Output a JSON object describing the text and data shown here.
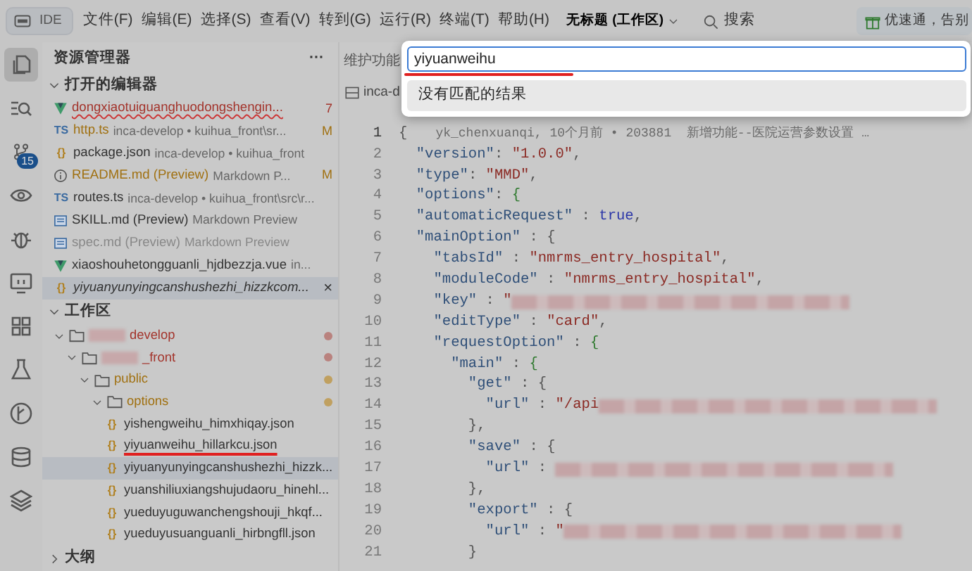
{
  "titlebar": {
    "logo": "IDE",
    "menus": [
      "文件(F)",
      "编辑(E)",
      "选择(S)",
      "查看(V)",
      "转到(G)",
      "运行(R)",
      "终端(T)",
      "帮助(H)"
    ],
    "workspace": "无标题 (工作区)",
    "search": "搜索",
    "promo": "优速通，告别"
  },
  "activity_bar": [
    {
      "kind": "files",
      "selected": true
    },
    {
      "kind": "search",
      "selected": false
    },
    {
      "kind": "source-control",
      "selected": false,
      "badge": "15"
    },
    {
      "kind": "eye",
      "selected": false
    },
    {
      "kind": "debug",
      "selected": false
    },
    {
      "kind": "monitor",
      "selected": false
    },
    {
      "kind": "extensions",
      "selected": false
    },
    {
      "kind": "flask",
      "selected": false
    },
    {
      "kind": "graph",
      "selected": false
    },
    {
      "kind": "database",
      "selected": false
    },
    {
      "kind": "layers",
      "selected": false
    }
  ],
  "sidebar": {
    "title": "资源管理器",
    "more": "···",
    "open_editors": {
      "title": "打开的编辑器",
      "expanded": true,
      "items": [
        {
          "kind": "vue",
          "name": "dongxiaotuiguanghuodongshengin...",
          "badge": "7",
          "error": true,
          "modified": false,
          "dimmed": false,
          "selected": false,
          "preview": false
        },
        {
          "kind": "ts",
          "icon_text": "TS",
          "name": "http.ts",
          "detail": "inca-develop • kuihua_front\\sr...",
          "badge": "M",
          "error": false,
          "modified": true,
          "dimmed": false,
          "selected": false,
          "preview": false
        },
        {
          "kind": "json",
          "icon_text": "{}",
          "name": "package.json",
          "detail": "inca-develop • kuihua_front",
          "error": false,
          "modified": false,
          "dimmed": false,
          "selected": false,
          "preview": false
        },
        {
          "kind": "info",
          "name": "README.md (Preview)",
          "detail": "Markdown P...",
          "badge": "M",
          "error": false,
          "modified": true,
          "dimmed": false,
          "selected": false,
          "preview": false
        },
        {
          "kind": "ts",
          "icon_text": "TS",
          "name": "routes.ts",
          "detail": "inca-develop • kuihua_front\\src\\r...",
          "error": false,
          "modified": false,
          "dimmed": false,
          "selected": false,
          "preview": false
        },
        {
          "kind": "md",
          "name": "SKILL.md (Preview)",
          "detail": "Markdown Preview",
          "error": false,
          "modified": false,
          "dimmed": false,
          "selected": false,
          "preview": false
        },
        {
          "kind": "md",
          "name": "spec.md (Preview)",
          "detail": "Markdown Preview",
          "error": false,
          "modified": false,
          "dimmed": true,
          "selected": false,
          "preview": false
        },
        {
          "kind": "vue",
          "name": "xiaoshouhetongguanli_hjdbezzja.vue",
          "detail": "in...",
          "error": false,
          "modified": false,
          "dimmed": false,
          "selected": false,
          "preview": false
        },
        {
          "kind": "json",
          "icon_text": "{}",
          "name": "yiyuanyunyingcanshushezhi_hizzkcom...",
          "error": false,
          "modified": false,
          "dimmed": false,
          "selected": true,
          "preview": true,
          "close": "×"
        }
      ]
    },
    "workspace": {
      "title": "工作区",
      "expanded": true,
      "tree": [
        {
          "name": "develop",
          "redacted": true,
          "error": true,
          "modified": false,
          "expanded": true,
          "children": [
            {
              "name": "_front",
              "redacted": true,
              "error": true,
              "modified": false,
              "expanded": true,
              "children": [
                {
                  "name": "public",
                  "redacted": false,
                  "error": false,
                  "modified": true,
                  "expanded": true,
                  "children": [
                    {
                      "name": "options",
                      "redacted": false,
                      "error": false,
                      "modified": true,
                      "expanded": true,
                      "children": [
                        {
                          "icon_text": "{}",
                          "name": "yishengweihu_himxhiqay.json",
                          "selected": false,
                          "underlined": false
                        },
                        {
                          "icon_text": "{}",
                          "name": "yiyuanweihu_hillarkcu.json",
                          "selected": false,
                          "underlined": true
                        },
                        {
                          "icon_text": "{}",
                          "name": "yiyuanyunyingcanshushezhi_hizzk...",
                          "selected": true,
                          "underlined": false
                        },
                        {
                          "icon_text": "{}",
                          "name": "yuanshiliuxiangshujudaoru_hinehl...",
                          "selected": false,
                          "underlined": false
                        },
                        {
                          "icon_text": "{}",
                          "name": "yueduyuguwanchengshouji_hkqf...",
                          "selected": false,
                          "underlined": false
                        },
                        {
                          "icon_text": "{}",
                          "name": "yueduyusuanguanli_hirbngfll.json",
                          "selected": false,
                          "underlined": false
                        }
                      ]
                    }
                  ]
                }
              ]
            }
          ]
        }
      ]
    },
    "outline": {
      "title": "大纲",
      "expanded": false
    }
  },
  "editor": {
    "tab": "维护功能",
    "breadcrumb": "inca-d",
    "blame": "yk_chenxuanqi, 10个月前 • 203881  新增功能--医院运营参数设置 …",
    "lines": [
      {
        "number": "1",
        "current": true,
        "tokens": [
          {
            "kind": "punct",
            "text": "{"
          }
        ]
      },
      {
        "number": "2",
        "current": false,
        "tokens": [
          {
            "kind": "key",
            "text": "  \"version\""
          },
          {
            "kind": "punct",
            "text": ": "
          },
          {
            "kind": "string",
            "text": "\"1.0.0\""
          },
          {
            "kind": "punct",
            "text": ","
          }
        ]
      },
      {
        "number": "3",
        "current": false,
        "tokens": [
          {
            "kind": "key",
            "text": "  \"type\""
          },
          {
            "kind": "punct",
            "text": ": "
          },
          {
            "kind": "string",
            "text": "\"MMD\""
          },
          {
            "kind": "punct",
            "text": ","
          }
        ]
      },
      {
        "number": "4",
        "current": false,
        "tokens": [
          {
            "kind": "key",
            "text": "  \"options\""
          },
          {
            "kind": "punct",
            "text": ": "
          },
          {
            "kind": "brace",
            "text": "{"
          }
        ]
      },
      {
        "number": "5",
        "current": false,
        "tokens": [
          {
            "kind": "key",
            "text": "  \"automaticRequest\""
          },
          {
            "kind": "punct",
            "text": " : "
          },
          {
            "kind": "bool",
            "text": "true"
          },
          {
            "kind": "punct",
            "text": ","
          }
        ]
      },
      {
        "number": "6",
        "current": false,
        "tokens": [
          {
            "kind": "key",
            "text": "  \"mainOption\""
          },
          {
            "kind": "punct",
            "text": " : "
          },
          {
            "kind": "punct",
            "text": "{"
          }
        ]
      },
      {
        "number": "7",
        "current": false,
        "tokens": [
          {
            "kind": "key",
            "text": "    \"tabsId\""
          },
          {
            "kind": "punct",
            "text": " : "
          },
          {
            "kind": "string",
            "text": "\"nmrms_entry_hospital\""
          },
          {
            "kind": "punct",
            "text": ","
          }
        ]
      },
      {
        "number": "8",
        "current": false,
        "tokens": [
          {
            "kind": "key",
            "text": "    \"moduleCode\""
          },
          {
            "kind": "punct",
            "text": " : "
          },
          {
            "kind": "string",
            "text": "\"nmrms_entry_hospital\""
          },
          {
            "kind": "punct",
            "text": ","
          }
        ]
      },
      {
        "number": "9",
        "current": false,
        "tokens": [
          {
            "kind": "key",
            "text": "    \"key\""
          },
          {
            "kind": "punct",
            "text": " : "
          },
          {
            "kind": "string",
            "text": "\""
          },
          {
            "kind": "redacted"
          }
        ]
      },
      {
        "number": "10",
        "current": false,
        "tokens": [
          {
            "kind": "key",
            "text": "    \"editType\""
          },
          {
            "kind": "punct",
            "text": " : "
          },
          {
            "kind": "string",
            "text": "\"card\""
          },
          {
            "kind": "punct",
            "text": ","
          }
        ]
      },
      {
        "number": "11",
        "current": false,
        "tokens": [
          {
            "kind": "key",
            "text": "    \"requestOption\""
          },
          {
            "kind": "punct",
            "text": " : "
          },
          {
            "kind": "brace",
            "text": "{"
          }
        ]
      },
      {
        "number": "12",
        "current": false,
        "tokens": [
          {
            "kind": "key",
            "text": "      \"main\""
          },
          {
            "kind": "punct",
            "text": " : "
          },
          {
            "kind": "brace",
            "text": "{"
          }
        ]
      },
      {
        "number": "13",
        "current": false,
        "tokens": [
          {
            "kind": "key",
            "text": "        \"get\""
          },
          {
            "kind": "punct",
            "text": " : "
          },
          {
            "kind": "punct",
            "text": "{"
          }
        ]
      },
      {
        "number": "14",
        "current": false,
        "tokens": [
          {
            "kind": "key",
            "text": "          \"url\""
          },
          {
            "kind": "punct",
            "text": " : "
          },
          {
            "kind": "string",
            "text": "\"/api"
          },
          {
            "kind": "redacted"
          }
        ]
      },
      {
        "number": "15",
        "current": false,
        "tokens": [
          {
            "kind": "punct",
            "text": "        },"
          }
        ]
      },
      {
        "number": "16",
        "current": false,
        "tokens": [
          {
            "kind": "key",
            "text": "        \"save\""
          },
          {
            "kind": "punct",
            "text": " : "
          },
          {
            "kind": "punct",
            "text": "{"
          }
        ]
      },
      {
        "number": "17",
        "current": false,
        "tokens": [
          {
            "kind": "key",
            "text": "          \"url\""
          },
          {
            "kind": "punct",
            "text": " : "
          },
          {
            "kind": "redacted"
          }
        ]
      },
      {
        "number": "18",
        "current": false,
        "tokens": [
          {
            "kind": "punct",
            "text": "        },"
          }
        ]
      },
      {
        "number": "19",
        "current": false,
        "tokens": [
          {
            "kind": "key",
            "text": "        \"export\""
          },
          {
            "kind": "punct",
            "text": " : "
          },
          {
            "kind": "punct",
            "text": "{"
          }
        ]
      },
      {
        "number": "20",
        "current": false,
        "tokens": [
          {
            "kind": "key",
            "text": "          \"url\""
          },
          {
            "kind": "punct",
            "text": " : "
          },
          {
            "kind": "string",
            "text": "\""
          },
          {
            "kind": "redacted"
          }
        ]
      },
      {
        "number": "21",
        "current": false,
        "tokens": [
          {
            "kind": "punct",
            "text": "        }"
          }
        ]
      }
    ]
  },
  "quick_open": {
    "value": "yiyuanweihu",
    "underlined": true,
    "results": [
      {
        "text": "没有匹配的结果",
        "selected": true
      }
    ]
  }
}
